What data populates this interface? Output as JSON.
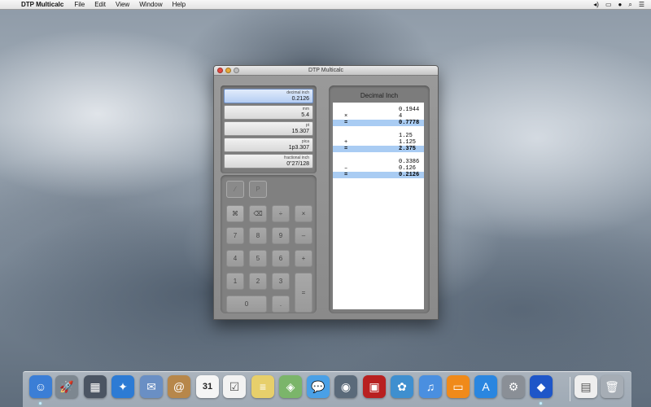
{
  "menubar": {
    "app_name": "DTP Multicalc",
    "menus": [
      "File",
      "Edit",
      "View",
      "Window",
      "Help"
    ]
  },
  "window": {
    "title": "DTP Multicalc"
  },
  "displays": [
    {
      "label": "decimal inch",
      "value": "0.2126",
      "active": true
    },
    {
      "label": "mm",
      "value": "5.4"
    },
    {
      "label": "pt",
      "value": "15.307"
    },
    {
      "label": "pica",
      "value": "1p3.307"
    },
    {
      "label": "fractional inch",
      "value": "0\"27/128"
    }
  ],
  "keypad": {
    "mode_keys": [
      "⁄",
      "P"
    ],
    "keys": [
      "⌘",
      "⌫",
      "÷",
      "×",
      "7",
      "8",
      "9",
      "–",
      "4",
      "5",
      "6",
      "+",
      "1",
      "2",
      "3",
      "=",
      "0",
      "."
    ]
  },
  "tape": {
    "title": "Decimal Inch",
    "groups": [
      {
        "rows": [
          {
            "op": "",
            "num": "0.1944"
          },
          {
            "op": "×",
            "num": "4"
          },
          {
            "op": "=",
            "num": "0.7778",
            "result": true
          }
        ]
      },
      {
        "rows": [
          {
            "op": "",
            "num": "1.25"
          },
          {
            "op": "+",
            "num": "1.125"
          },
          {
            "op": "=",
            "num": "2.375",
            "result": true
          }
        ]
      },
      {
        "rows": [
          {
            "op": "",
            "num": "0.3386"
          },
          {
            "op": "–",
            "num": "0.126"
          },
          {
            "op": "=",
            "num": "0.2126",
            "result": true
          }
        ]
      }
    ]
  },
  "dock": {
    "apps": [
      {
        "name": "finder-icon",
        "glyph": "☺",
        "color": "#3b7ed6"
      },
      {
        "name": "launchpad-icon",
        "glyph": "🚀",
        "color": "#7d8790"
      },
      {
        "name": "mission-control-icon",
        "glyph": "▦",
        "color": "#4b5563"
      },
      {
        "name": "safari-icon",
        "glyph": "✦",
        "color": "#2d7bd4"
      },
      {
        "name": "mail-icon",
        "glyph": "✉",
        "color": "#6a8fc4"
      },
      {
        "name": "contacts-icon",
        "glyph": "@",
        "color": "#b7874a"
      },
      {
        "name": "calendar-icon",
        "glyph": "31",
        "color": "#f5f5f5"
      },
      {
        "name": "reminders-icon",
        "glyph": "☑",
        "color": "#f2f2f2"
      },
      {
        "name": "notes-icon",
        "glyph": "≡",
        "color": "#e7cf6b"
      },
      {
        "name": "maps-icon",
        "glyph": "◈",
        "color": "#7bb56a"
      },
      {
        "name": "messages-icon",
        "glyph": "💬",
        "color": "#4aa0e6"
      },
      {
        "name": "facetime-icon",
        "glyph": "◉",
        "color": "#5a6a7a"
      },
      {
        "name": "photo-booth-icon",
        "glyph": "▣",
        "color": "#b82020"
      },
      {
        "name": "iphoto-icon",
        "glyph": "✿",
        "color": "#3f8fcf"
      },
      {
        "name": "itunes-icon",
        "glyph": "♫",
        "color": "#4a8fe0"
      },
      {
        "name": "ibooks-icon",
        "glyph": "▭",
        "color": "#f08a1a"
      },
      {
        "name": "app-store-icon",
        "glyph": "A",
        "color": "#2a86e0"
      },
      {
        "name": "system-preferences-icon",
        "glyph": "⚙",
        "color": "#8a8f96"
      },
      {
        "name": "dtp-multicalc-icon",
        "glyph": "◆",
        "color": "#1e56c8"
      },
      {
        "name": "documents-stack-icon",
        "glyph": "▤",
        "color": "#eeeeee"
      },
      {
        "name": "trash-icon",
        "glyph": "🗑",
        "color": "#a6adb5"
      }
    ]
  }
}
